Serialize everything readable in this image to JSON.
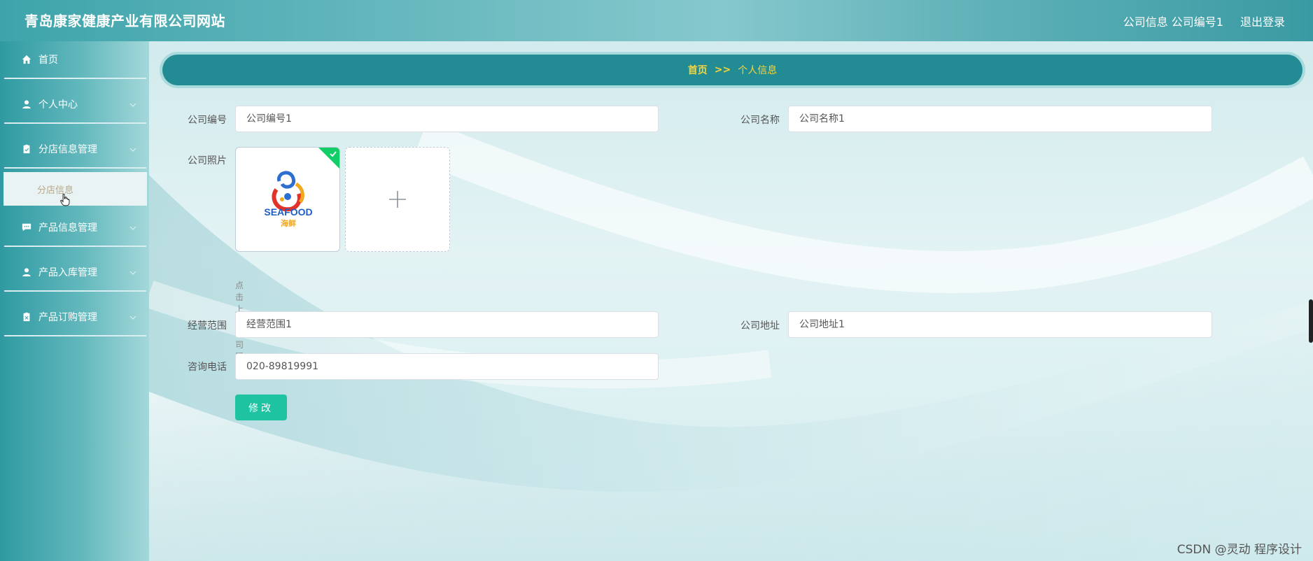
{
  "header": {
    "brand": "青岛康家健康产业有限公司网站",
    "user_info": "公司信息 公司编号1",
    "logout": "退出登录"
  },
  "sidebar": {
    "items": [
      {
        "label": "首页",
        "icon": "home-icon"
      },
      {
        "label": "个人中心",
        "icon": "user-icon"
      },
      {
        "label": "分店信息管理",
        "icon": "clipboard-icon"
      },
      {
        "label": "产品信息管理",
        "icon": "chat-icon"
      },
      {
        "label": "产品入库管理",
        "icon": "user-icon"
      },
      {
        "label": "产品订购管理",
        "icon": "clipboard-x-icon"
      }
    ],
    "submenu": {
      "label": "分店信息"
    }
  },
  "breadcrumb": {
    "home": "首页",
    "separator": ">>",
    "current": "个人信息"
  },
  "form": {
    "company_no_label": "公司编号",
    "company_no_value": "公司编号1",
    "company_name_label": "公司名称",
    "company_name_value": "公司名称1",
    "photo_label": "公司照片",
    "logo_text_top": "SEAFOOD",
    "logo_text_bottom": "海鲜",
    "upload_tip": "点击上传公司照片",
    "scope_label": "经营范围",
    "scope_value": "经营范围1",
    "address_label": "公司地址",
    "address_value": "公司地址1",
    "phone_label": "咨询电话",
    "phone_value": "020-89819991",
    "submit_label": "修改"
  },
  "watermark": "CSDN @灵动 程序设计",
  "colors": {
    "accent": "#238b93",
    "highlight": "#f5d53e",
    "button": "#1ec3a1",
    "success": "#13ce66"
  }
}
